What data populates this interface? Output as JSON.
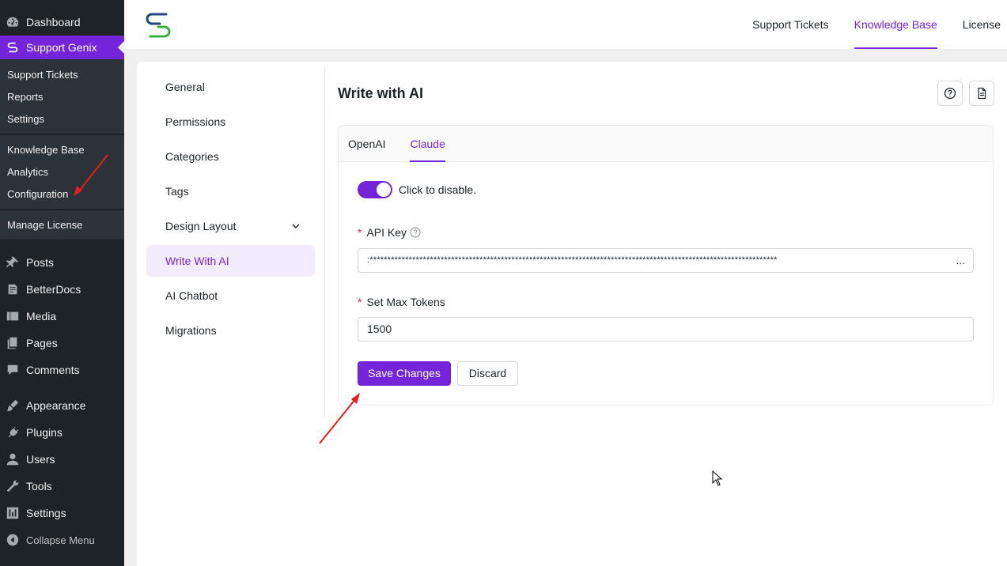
{
  "wp_menu": {
    "dashboard": "Dashboard",
    "current": "Support Genix",
    "submenu": [
      "Support Tickets",
      "Reports",
      "Settings"
    ],
    "submenu2": [
      "Knowledge Base",
      "Analytics",
      "Configuration"
    ],
    "submenu3": [
      "Manage License"
    ],
    "items": [
      {
        "label": "Posts",
        "icon": "pin-icon"
      },
      {
        "label": "BetterDocs",
        "icon": "docs-icon"
      },
      {
        "label": "Media",
        "icon": "media-icon"
      },
      {
        "label": "Pages",
        "icon": "pages-icon"
      },
      {
        "label": "Comments",
        "icon": "comments-icon"
      },
      {
        "label": "Appearance",
        "icon": "brush-icon"
      },
      {
        "label": "Plugins",
        "icon": "plug-icon"
      },
      {
        "label": "Users",
        "icon": "user-icon"
      },
      {
        "label": "Tools",
        "icon": "wrench-icon"
      },
      {
        "label": "Settings",
        "icon": "sliders-icon"
      }
    ],
    "collapse": "Collapse Menu"
  },
  "topnav": [
    "Support Tickets",
    "Knowledge Base",
    "License"
  ],
  "settings_nav": [
    "General",
    "Permissions",
    "Categories",
    "Tags",
    "Design Layout",
    "Write With AI",
    "AI Chatbot",
    "Migrations"
  ],
  "content": {
    "title": "Write with AI",
    "tabs": [
      "OpenAI",
      "Claude"
    ],
    "toggle_label": "Click to disable.",
    "api_key_label": "API Key",
    "api_key_value": ":*******************************************************************************************************************",
    "api_key_more": "...",
    "max_tokens_label": "Set Max Tokens",
    "max_tokens_value": "1500",
    "save": "Save Changes",
    "discard": "Discard"
  },
  "colors": {
    "accent": "#7424d9",
    "wp_sidebar": "#1d2327",
    "wp_sub": "#2c3338",
    "required": "#e0243b",
    "annotation": "#e51d1d"
  }
}
